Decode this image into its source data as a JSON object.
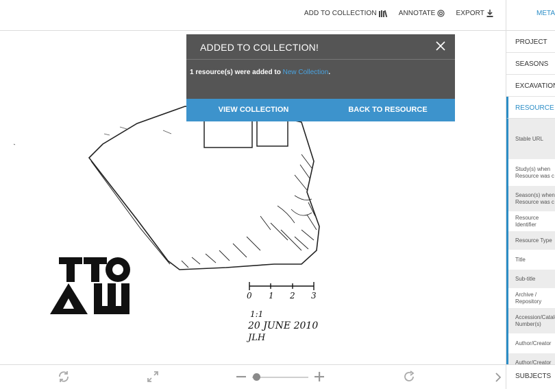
{
  "toolbar": {
    "add_to_collection": "ADD TO COLLECTION",
    "annotate": "ANNOTATE",
    "export": "EXPORT"
  },
  "modal": {
    "title": "ADDED TO COLLECTION!",
    "message_prefix": "1 resource(s) were added to",
    "collection_link": "New Collection",
    "message_suffix": ".",
    "view_button": "VIEW COLLECTION",
    "back_button": "BACK TO RESOURCE"
  },
  "drawing": {
    "scale_ticks": [
      "0",
      "1",
      "2",
      "3"
    ],
    "scale_note": "1:1",
    "date_note": "20 JUNE 2010",
    "initials": "JLH"
  },
  "zoom": {
    "level": 0.05
  },
  "panel": {
    "header": "METADATA",
    "sections": [
      "PROJECT",
      "SEASONS",
      "EXCAVATION",
      "RESOURCE"
    ],
    "fields": [
      "Stable URL",
      "Study(s) when Resource was c",
      "Season(s) when Resource was c",
      "Resource Identifier",
      "Resource Type",
      "Title",
      "Sub-title",
      "Archive / Repository",
      "Accession/Catalog Number(s)",
      "Author/Creator",
      "Author/Creator"
    ],
    "footer": "SUBJECTS"
  },
  "colors": {
    "accent": "#2b8dc6",
    "modal_bg": "#555555",
    "modal_buttons": "#3d93cc"
  }
}
